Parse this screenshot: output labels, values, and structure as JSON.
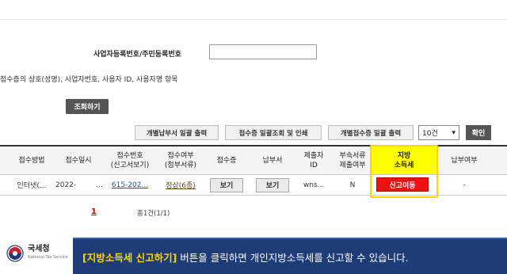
{
  "search": {
    "bizno_label": "사업자등록번호/주민등록번호",
    "bizno_value": "",
    "note": "접수증의 상호(성명), 사업자번호, 사용자 ID, 사용자명 항목",
    "search_button": "조회하기"
  },
  "toolbar": {
    "bulk_payment_print": "개별납부서 일괄 출력",
    "bulk_receipt_print": "접수증 일괄조회 및 인쇄",
    "bulk_individual_receipt_print": "개별접수증 일괄 출력",
    "count_select": "10건",
    "confirm_button": "확인"
  },
  "table": {
    "headers": {
      "method": "접수방법",
      "date": "접수일시",
      "receipt_no_1": "접수번호",
      "receipt_no_2": "(신고서보기)",
      "status_1": "접수여부",
      "status_2": "(첨부서류)",
      "receipt": "접수증",
      "payment": "납부서",
      "submitter_1": "제출자",
      "submitter_2": "ID",
      "attach_1": "부속서류",
      "attach_2": "제출여부",
      "local_tax_1": "지방",
      "local_tax_2": "소득세",
      "paid": "납부여부"
    },
    "rows": [
      {
        "method": "인터넷(...",
        "date": "2022-",
        "date_more": "...",
        "receipt_no": "615-202...",
        "status": "정상(6종)",
        "receipt_btn": "보기",
        "payment_btn": "보기",
        "submitter": "wns...",
        "attach": "N",
        "local_tax_btn": "신고이동",
        "paid": "-"
      }
    ]
  },
  "pagination": {
    "current": "1",
    "total": "총1건(1/1)"
  },
  "footer": {
    "logo_ko": "국세청",
    "logo_en": "National Tax Service",
    "caption_highlight": "[지방소득세 신고하기]",
    "caption_rest": " 버튼을 클릭하면 개인지방소득세를 신고할 수 있습니다."
  },
  "colors": {
    "highlight": "#ffff00",
    "action_red": "#ee1111",
    "banner_navy": "#1e3c78"
  }
}
